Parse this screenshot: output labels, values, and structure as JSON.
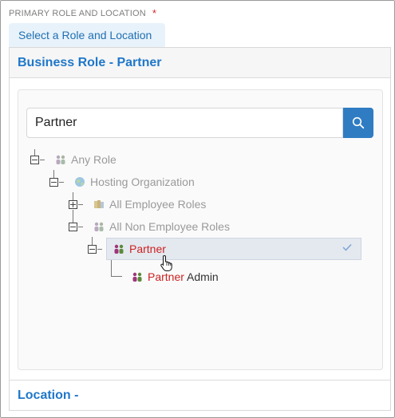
{
  "section": {
    "label": "PRIMARY ROLE AND LOCATION",
    "required_mark": "*"
  },
  "tab": {
    "label": "Select a Role and Location"
  },
  "business_role": {
    "title": "Business Role - Partner"
  },
  "search": {
    "value": "Partner",
    "icon": "search-icon"
  },
  "tree": {
    "any_role": "Any Role",
    "hosting_org": "Hosting Organization",
    "all_employee": "All Employee Roles",
    "all_non_employee": "All Non Employee Roles",
    "partner": "Partner",
    "partner_admin_highlight": "Partner",
    "partner_admin_rest": " Admin"
  },
  "location": {
    "title": "Location -"
  },
  "colors": {
    "accent": "#1f77c9",
    "search_button": "#2f7cc3",
    "match_highlight": "#cc2222",
    "required": "#d9262f"
  }
}
